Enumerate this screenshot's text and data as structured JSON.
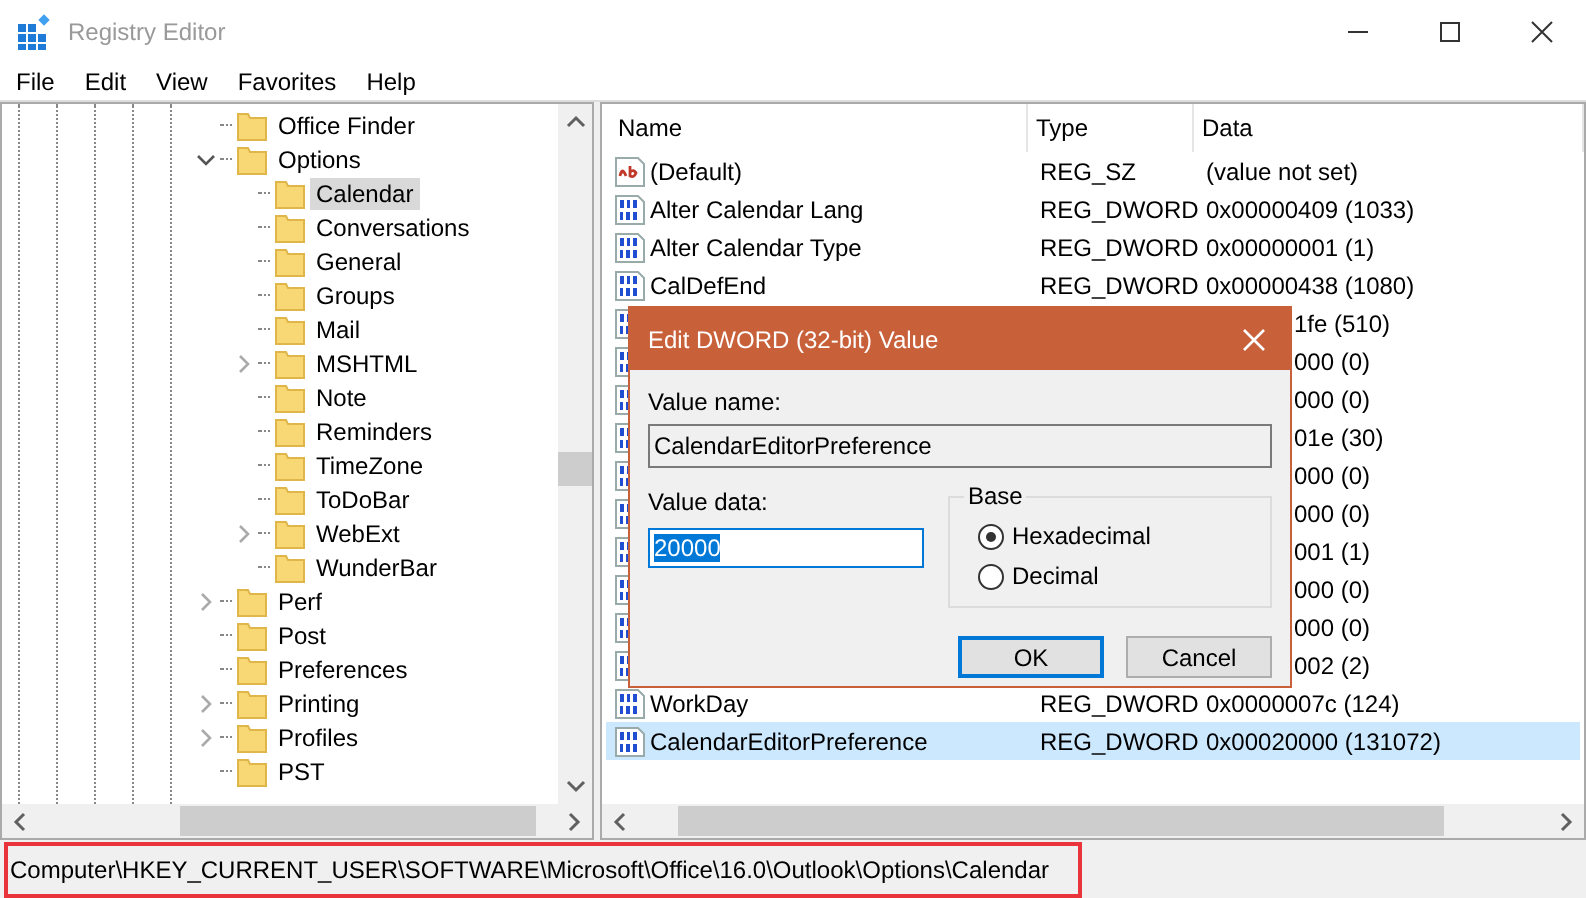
{
  "window": {
    "title": "Registry Editor"
  },
  "menu": [
    "File",
    "Edit",
    "View",
    "Favorites",
    "Help"
  ],
  "tree": [
    {
      "label": "Office Finder",
      "selected": false
    },
    {
      "label": "Options",
      "selected": false,
      "expanded": true,
      "children": [
        {
          "label": "Calendar",
          "selected": true
        },
        {
          "label": "Conversations",
          "selected": false
        },
        {
          "label": "General",
          "selected": false
        },
        {
          "label": "Groups",
          "selected": false
        },
        {
          "label": "Mail",
          "selected": false
        },
        {
          "label": "MSHTML",
          "selected": false,
          "expanded": false
        },
        {
          "label": "Note",
          "selected": false
        },
        {
          "label": "Reminders",
          "selected": false
        },
        {
          "label": "TimeZone",
          "selected": false
        },
        {
          "label": "ToDoBar",
          "selected": false
        },
        {
          "label": "WebExt",
          "selected": false,
          "expanded": false
        },
        {
          "label": "WunderBar",
          "selected": false
        }
      ]
    },
    {
      "label": "Perf",
      "selected": false,
      "expanded": false
    },
    {
      "label": "Post",
      "selected": false
    },
    {
      "label": "Preferences",
      "selected": false
    },
    {
      "label": "Printing",
      "selected": false,
      "expanded": false
    },
    {
      "label": "Profiles",
      "selected": false,
      "expanded": false
    },
    {
      "label": "PST",
      "selected": false
    }
  ],
  "list": {
    "columns": [
      "Name",
      "Type",
      "Data"
    ],
    "rows": [
      {
        "kind": "sz",
        "name": "(Default)",
        "type": "REG_SZ",
        "data": "(value not set)",
        "covered": false,
        "selected": false
      },
      {
        "kind": "dword",
        "name": "Alter Calendar Lang",
        "type": "REG_DWORD",
        "data": "0x00000409 (1033)",
        "covered": false,
        "selected": false
      },
      {
        "kind": "dword",
        "name": "Alter Calendar Type",
        "type": "REG_DWORD",
        "data": "0x00000001 (1)",
        "covered": false,
        "selected": false
      },
      {
        "kind": "dword",
        "name": "CalDefEnd",
        "type": "REG_DWORD",
        "data": "0x00000438 (1080)",
        "covered": false,
        "selected": false
      },
      {
        "kind": "dword",
        "data": "1fe (510)",
        "covered": true,
        "selected": false
      },
      {
        "kind": "dword",
        "data": "000 (0)",
        "covered": true,
        "selected": false
      },
      {
        "kind": "dword",
        "data": "000 (0)",
        "covered": true,
        "selected": false
      },
      {
        "kind": "dword",
        "data": "01e (30)",
        "covered": true,
        "selected": false
      },
      {
        "kind": "dword",
        "data": "000 (0)",
        "covered": true,
        "selected": false
      },
      {
        "kind": "dword",
        "data": "000 (0)",
        "covered": true,
        "selected": false
      },
      {
        "kind": "dword",
        "data": "001 (1)",
        "covered": true,
        "selected": false
      },
      {
        "kind": "dword",
        "data": "000 (0)",
        "covered": true,
        "selected": false
      },
      {
        "kind": "dword",
        "data": "000 (0)",
        "covered": true,
        "selected": false
      },
      {
        "kind": "dword",
        "data": "002 (2)",
        "covered": true,
        "selected": false
      },
      {
        "kind": "dword",
        "name": "WorkDay",
        "type": "REG_DWORD",
        "data": "0x0000007c (124)",
        "covered": false,
        "selected": false
      },
      {
        "kind": "dword",
        "name": "CalendarEditorPreference",
        "type": "REG_DWORD",
        "data": "0x00020000 (131072)",
        "covered": false,
        "selected": true
      }
    ]
  },
  "dialog": {
    "title": "Edit DWORD (32-bit) Value",
    "value_name_label": "Value name:",
    "value_name": "CalendarEditorPreference",
    "value_data_label": "Value data:",
    "value_data": "20000",
    "value_data_selected": true,
    "base_label": "Base",
    "bases": [
      {
        "label": "Hexadecimal",
        "selected": true
      },
      {
        "label": "Decimal",
        "selected": false
      }
    ],
    "buttons": [
      {
        "label": "OK",
        "default": true
      },
      {
        "label": "Cancel",
        "default": false
      }
    ]
  },
  "status_bar": {
    "path": "Computer\\HKEY_CURRENT_USER\\SOFTWARE\\Microsoft\\Office\\16.0\\Outlook\\Options\\Calendar",
    "highlighted": true
  }
}
